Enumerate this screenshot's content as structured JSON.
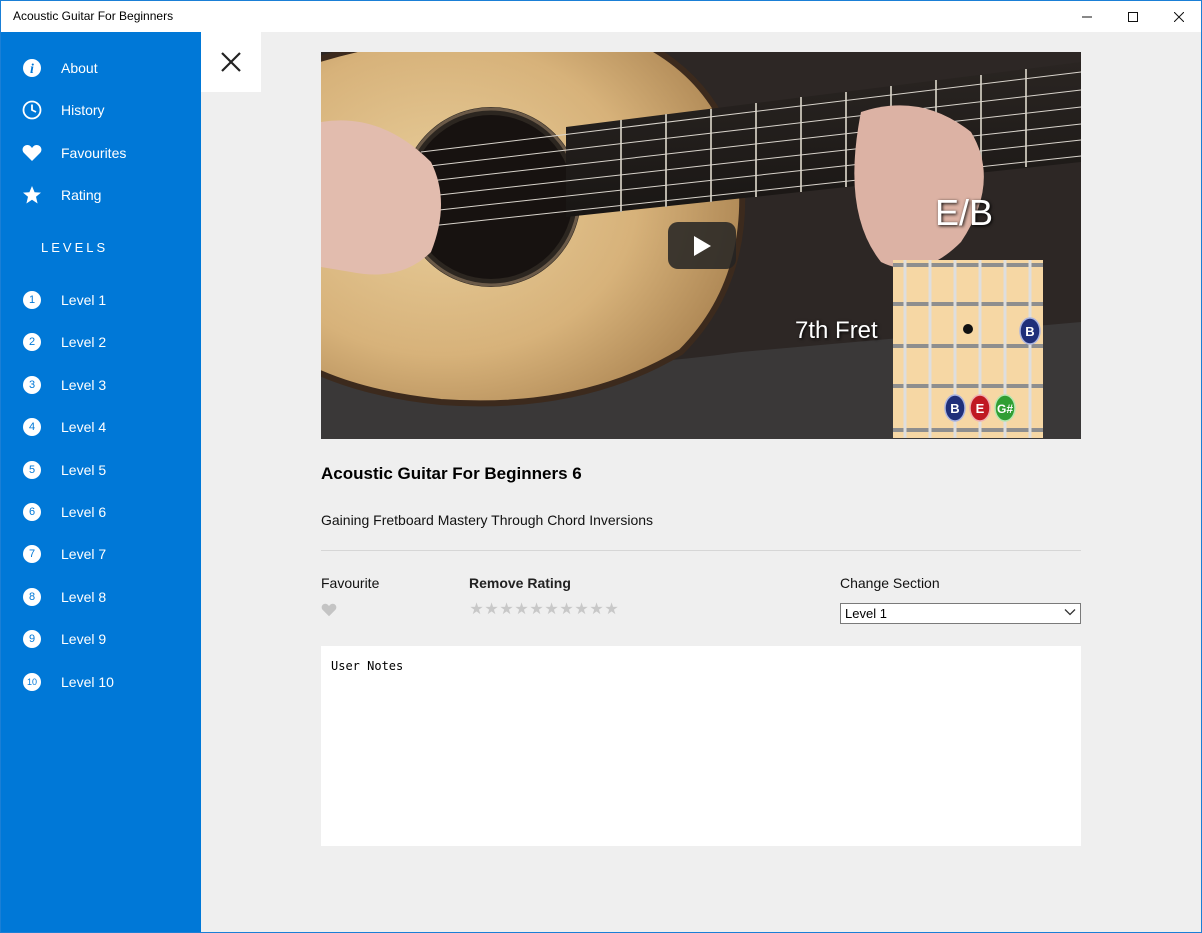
{
  "window": {
    "title": "Acoustic Guitar For Beginners"
  },
  "sidebar": {
    "items": [
      {
        "label": "About",
        "icon": "info-icon"
      },
      {
        "label": "History",
        "icon": "clock-icon"
      },
      {
        "label": "Favourites",
        "icon": "heart-icon"
      },
      {
        "label": "Rating",
        "icon": "star-icon"
      }
    ],
    "levels_heading": "LEVELS",
    "levels": [
      {
        "num": "1",
        "label": "Level 1"
      },
      {
        "num": "2",
        "label": "Level 2"
      },
      {
        "num": "3",
        "label": "Level 3"
      },
      {
        "num": "4",
        "label": "Level 4"
      },
      {
        "num": "5",
        "label": "Level 5"
      },
      {
        "num": "6",
        "label": "Level 6"
      },
      {
        "num": "7",
        "label": "Level 7"
      },
      {
        "num": "8",
        "label": "Level 8"
      },
      {
        "num": "9",
        "label": "Level 9"
      },
      {
        "num": "10",
        "label": "Level 10"
      }
    ],
    "color": "#0078d7"
  },
  "video": {
    "chord": "E/B",
    "fret_label": "7th Fret",
    "notes": [
      "B",
      "E",
      "G#",
      "B"
    ]
  },
  "lesson": {
    "title": "Acoustic Guitar For Beginners 6",
    "subtitle": "Gaining Fretboard Mastery Through Chord Inversions"
  },
  "controls": {
    "favourite_label": "Favourite",
    "rating_label": "Remove Rating",
    "rating_max": 10,
    "rating_value": 0,
    "section_label": "Change Section",
    "section_value": "Level 1"
  },
  "notes": {
    "placeholder": "User Notes"
  }
}
